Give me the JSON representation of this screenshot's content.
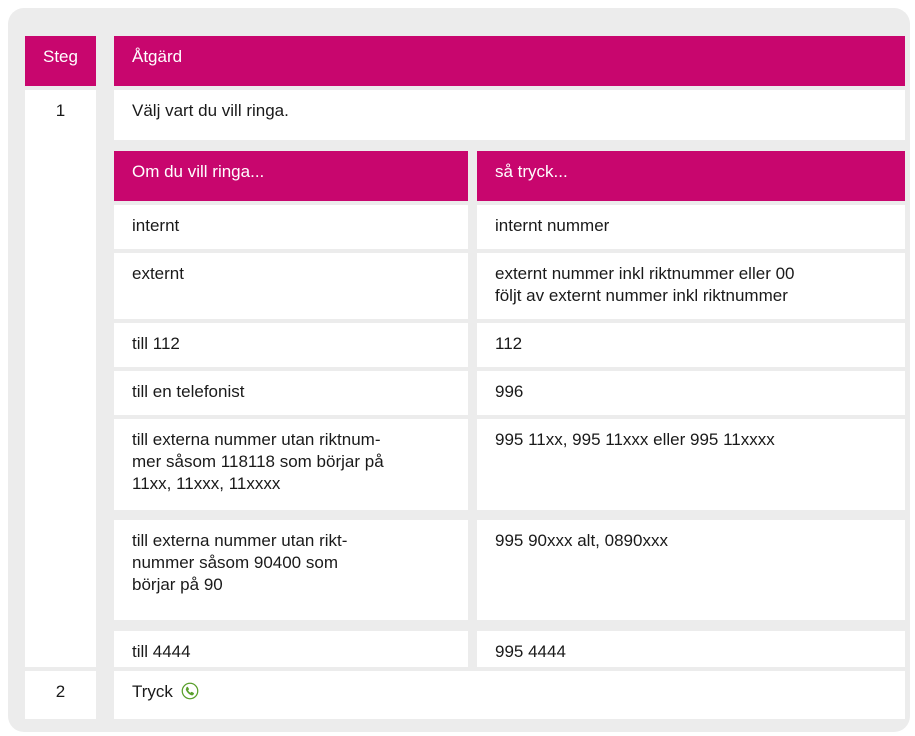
{
  "headers": {
    "steg": "Steg",
    "atgard": "Åtgärd"
  },
  "step1": {
    "number": "1",
    "text": "Välj vart du vill ringa.",
    "subheaders": {
      "om": "Om du vill ringa...",
      "sa": "så tryck..."
    },
    "rows": [
      {
        "left": [
          "internt"
        ],
        "right": [
          "internt nummer"
        ]
      },
      {
        "left": [
          "externt"
        ],
        "right": [
          "externt nummer inkl riktnummer eller 00",
          "följt av externt nummer inkl riktnummer"
        ]
      },
      {
        "left": [
          "till 112"
        ],
        "right": [
          "112"
        ]
      },
      {
        "left": [
          "till en telefonist"
        ],
        "right": [
          "996"
        ]
      },
      {
        "left": [
          "till externa nummer utan riktnum-",
          "mer såsom 118118 som börjar på",
          "11xx, 11xxx, 11xxxx"
        ],
        "right": [
          "995 11xx, 995 11xxx eller 995 11xxxx"
        ]
      },
      {
        "left": [
          "till externa nummer utan rikt-",
          "nummer såsom 90400 som",
          "börjar på 90"
        ],
        "right": [
          "995 90xxx alt, 0890xxx"
        ]
      },
      {
        "left": [
          "till 4444"
        ],
        "right": [
          "995 4444"
        ]
      }
    ]
  },
  "step2": {
    "number": "2",
    "text": "Tryck",
    "icon": "phone-answer-icon",
    "icon_color": "#5aa02c"
  },
  "colors": {
    "accent": "#c8066e",
    "panel": "#ececec"
  }
}
